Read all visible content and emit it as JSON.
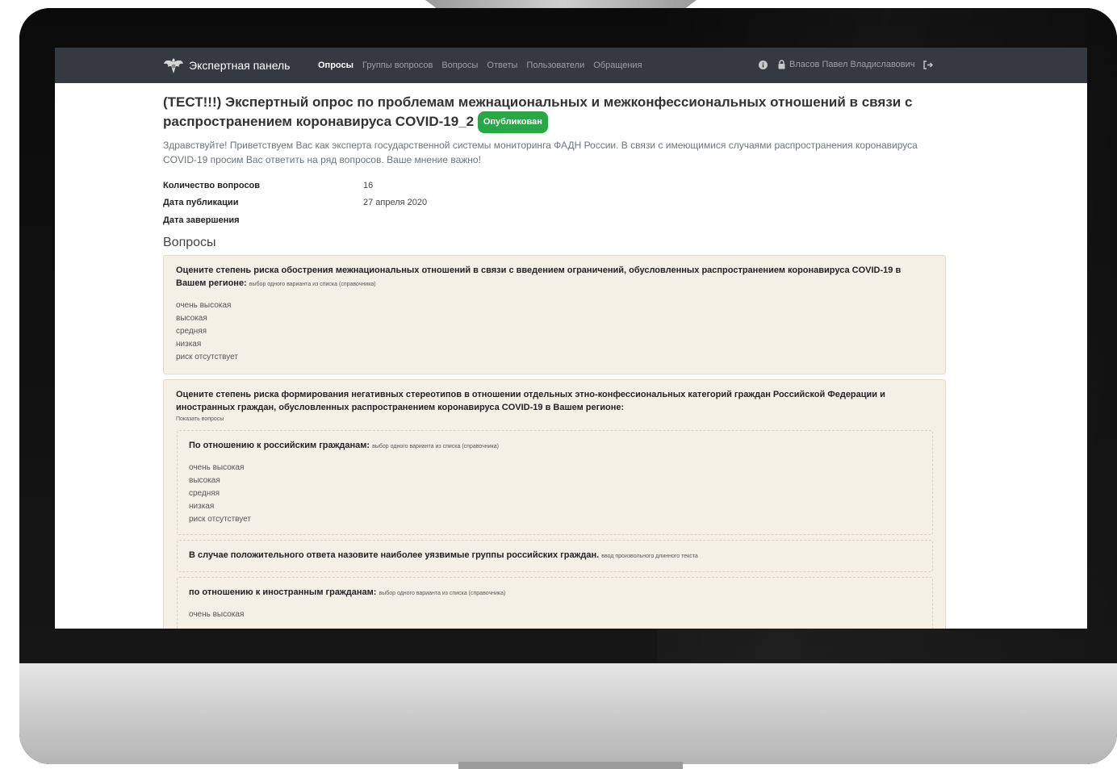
{
  "navbar": {
    "brand": "Экспертная панель",
    "links": [
      {
        "label": "Опросы",
        "active": true
      },
      {
        "label": "Группы вопросов",
        "active": false
      },
      {
        "label": "Вопросы",
        "active": false
      },
      {
        "label": "Ответы",
        "active": false
      },
      {
        "label": "Пользователи",
        "active": false
      },
      {
        "label": "Обращения",
        "active": false
      }
    ],
    "info_icon": "info-circle-icon",
    "user_icon": "user-lock-icon",
    "user_name": "Власов Павел Владиславович",
    "logout_icon": "sign-out-icon"
  },
  "survey": {
    "title": "(ТЕСТ!!!) Экспертный опрос по проблемам межнациональных и межконфессиональных отношений в связи с распространением коронавируса COVID-19_2",
    "status": "Опубликован",
    "intro": "Здравствуйте! Приветствуем Вас как эксперта государственной системы мониторинга ФАДН России. В связи с имеющимися случаями распространения коронавируса COVID-19 просим Вас ответить на ряд вопросов. Ваше мнение важно!",
    "meta": {
      "questions_count_label": "Количество вопросов",
      "questions_count": "16",
      "published_label": "Дата публикации",
      "published": "27 апреля 2020",
      "finished_label": "Дата завершения",
      "finished": ""
    }
  },
  "questions_section": {
    "title": "Вопросы",
    "q1": {
      "text": "Оцените степень риска обострения межнациональных отношений в связи с введением ограничений, обусловленных распространением коронавируса COVID-19 в Вашем регионе:",
      "type": "выбор одного варианта из списка (справочника)",
      "options": [
        "очень высокая",
        "высокая",
        "средняя",
        "низкая",
        "риск отсутствует"
      ]
    },
    "q2": {
      "text": "Оцените степень риска формирования негативных стереотипов в отношении отдельных этно-конфессиональных категорий граждан Российской Федерации и иностранных граждан, обусловленных распространением коронавируса COVID-19 в Вашем регионе:",
      "show_link": "Показать вопросы",
      "sub1": {
        "text": "По отношению к российским гражданам:",
        "type": "выбор одного варианта из списка (справочника)",
        "options": [
          "очень высокая",
          "высокая",
          "средняя",
          "низкая",
          "риск отсутствует"
        ]
      },
      "sub2": {
        "text": "В случае положительного ответа назовите наиболее уязвимые группы российских граждан.",
        "type": "ввод произвольного длинного текста"
      },
      "sub3": {
        "text": "по отношению к иностранным гражданам:",
        "type": "выбор одного варианта из списка (справочника)",
        "options": [
          "очень высокая"
        ]
      }
    }
  }
}
